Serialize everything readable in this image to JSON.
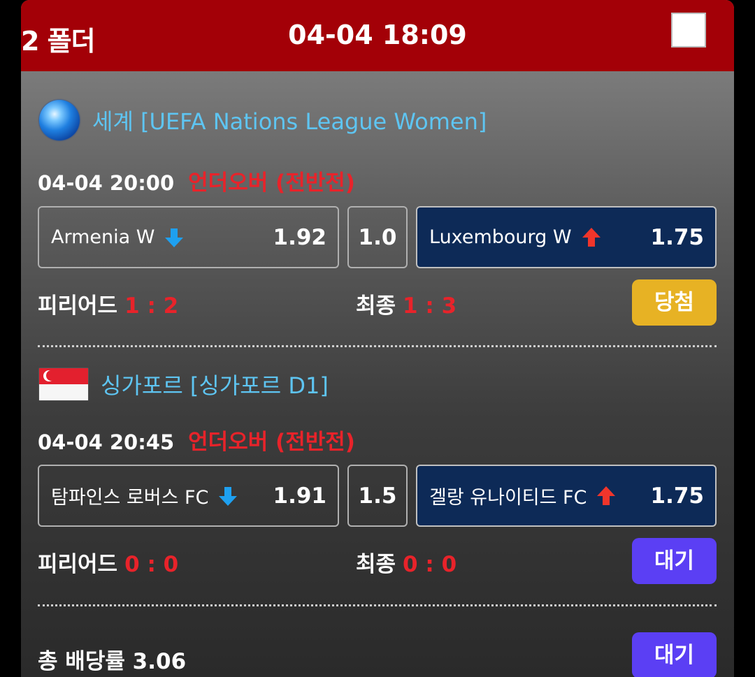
{
  "header": {
    "folder_label": "2 폴더",
    "time": "04-04 18:09"
  },
  "matches": [
    {
      "league": "세계 [UEFA Nations League Women]",
      "flag_icon": "globe-icon",
      "date": "04-04 20:00",
      "bet_type": "언더오버 (전반전)",
      "home_team": "Armenia W",
      "home_odd": "1.92",
      "home_arrow": "arrow-down-icon",
      "line": "1.0",
      "away_team": "Luxembourg W",
      "away_odd": "1.75",
      "away_arrow": "arrow-up-icon",
      "period_label": "피리어드",
      "period_score": "1 : 2",
      "final_label": "최종",
      "final_score": "1 : 3",
      "status": "당첨",
      "status_color": "#e7b224"
    },
    {
      "league": "싱가포르 [싱가포르 D1]",
      "flag_icon": "singapore-flag-icon",
      "date": "04-04 20:45",
      "bet_type": "언더오버 (전반전)",
      "home_team": "탐파인스 로버스 FC",
      "home_odd": "1.91",
      "home_arrow": "arrow-down-icon",
      "line": "1.5",
      "away_team": "겔랑 유나이티드 FC",
      "away_odd": "1.75",
      "away_arrow": "arrow-up-icon",
      "period_label": "피리어드",
      "period_score": "0 : 0",
      "final_label": "최종",
      "final_score": "0 : 0",
      "status": "대기",
      "status_color": "#5b3ff4"
    }
  ],
  "total": {
    "label": "총 배당률 3.06",
    "status": "대기"
  },
  "colors": {
    "header_bg": "#a30007",
    "league_text": "#5ec5f2",
    "bet_type_text": "#e8232a",
    "away_box_bg": "#0d2a57",
    "arrow_down": "#1ea0f0",
    "arrow_up": "#f0352b"
  }
}
